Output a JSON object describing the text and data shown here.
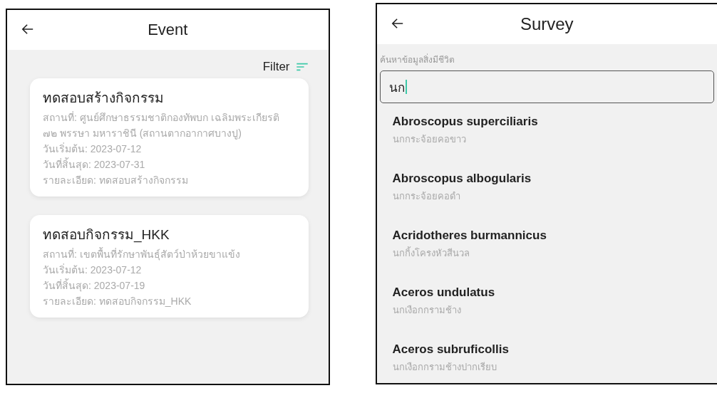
{
  "event_screen": {
    "title": "Event",
    "filter_label": "Filter",
    "events": [
      {
        "title": "ทดสอบสร้างกิจกรรม",
        "details": [
          "สถานที่: ศูนย์ศึกษาธรรมชาติกองทัพบก เฉลิมพระเกียรติ ๗๒ พรรษา มหาราชินี (สถานตากอากาศบางปู)",
          "วันเริ่มต้น: 2023-07-12",
          "วันที่สิ้นสุด: 2023-07-31",
          "รายละเอียด: ทดสอบสร้างกิจกรรม"
        ]
      },
      {
        "title": "ทดสอบกิจกรรม_HKK",
        "details": [
          "สถานที่: เขตพื้นที่รักษาพันธุ์สัตว์ป่าห้วยขาแข้ง",
          "วันเริ่มต้น: 2023-07-12",
          "วันที่สิ้นสุด: 2023-07-19",
          "รายละเอียด: ทดสอบกิจกรรม_HKK"
        ]
      }
    ]
  },
  "survey_screen": {
    "title": "Survey",
    "search_label": "ค้นหาข้อมูลสิ่งมีชีวิต",
    "search_value": "นก",
    "results": [
      {
        "name": "Abroscopus superciliaris",
        "thai_name": "นกกระจ้อยคอขาว"
      },
      {
        "name": "Abroscopus albogularis",
        "thai_name": "นกกระจ้อยคอดำ"
      },
      {
        "name": "Acridotheres burmannicus",
        "thai_name": "นกกิ้งโครงหัวสีนวล"
      },
      {
        "name": "Aceros undulatus",
        "thai_name": "นกเงือกกรามช้าง"
      },
      {
        "name": "Aceros subruficollis",
        "thai_name": "นกเงือกกรามช้างปากเรียบ"
      }
    ]
  }
}
